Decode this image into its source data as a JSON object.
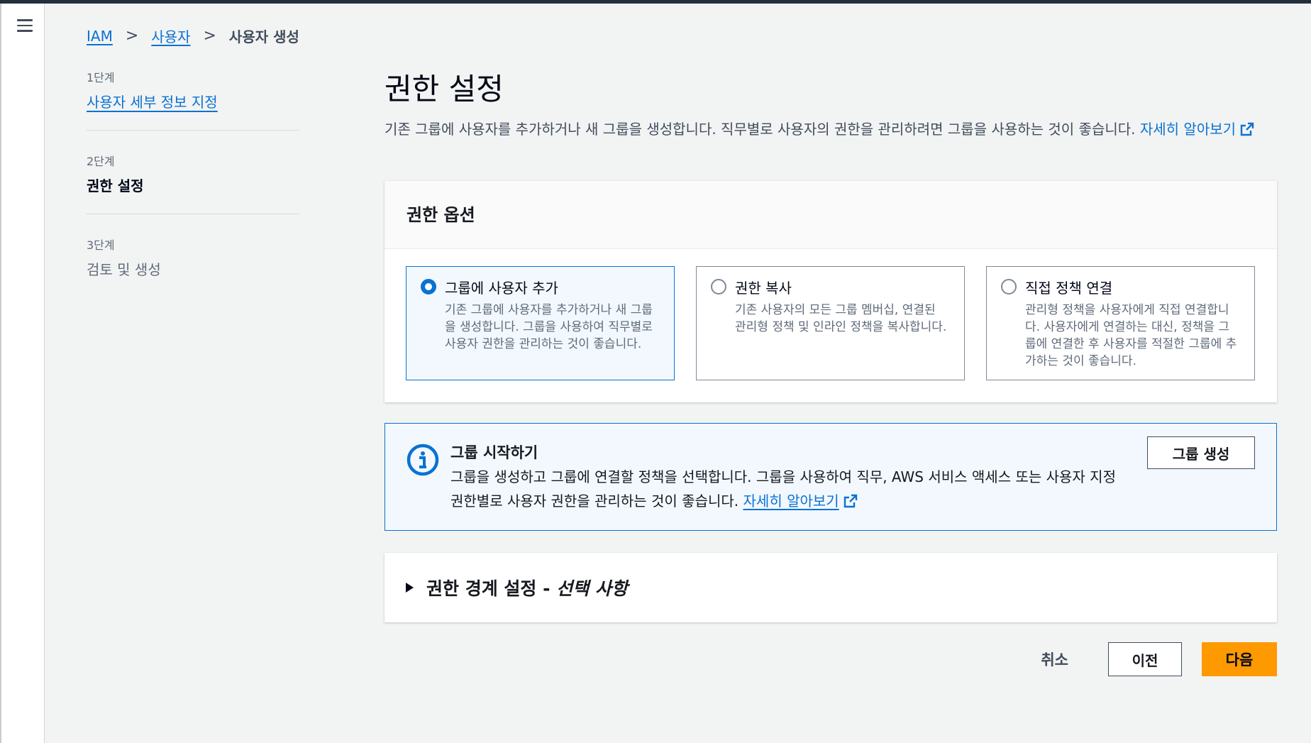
{
  "breadcrumb": {
    "iam": "IAM",
    "users": "사용자",
    "current": "사용자 생성"
  },
  "steps": [
    {
      "num": "1단계",
      "label": "사용자 세부 정보 지정"
    },
    {
      "num": "2단계",
      "label": "권한 설정"
    },
    {
      "num": "3단계",
      "label": "검토 및 생성"
    }
  ],
  "page": {
    "title": "권한 설정",
    "description": "기존 그룹에 사용자를 추가하거나 새 그룹을 생성합니다. 직무별로 사용자의 권한을 관리하려면 그룹을 사용하는 것이 좋습니다. ",
    "learn_more": "자세히 알아보기"
  },
  "permissions": {
    "header": "권한 옵션",
    "options": [
      {
        "title": "그룹에 사용자 추가",
        "desc": "기존 그룹에 사용자를 추가하거나 새 그룹을 생성합니다. 그룹을 사용하여 직무별로 사용자 권한을 관리하는 것이 좋습니다.",
        "selected": true
      },
      {
        "title": "권한 복사",
        "desc": "기존 사용자의 모든 그룹 멤버십, 연결된 관리형 정책 및 인라인 정책을 복사합니다.",
        "selected": false
      },
      {
        "title": "직접 정책 연결",
        "desc": "관리형 정책을 사용자에게 직접 연결합니다. 사용자에게 연결하는 대신, 정책을 그룹에 연결한 후 사용자를 적절한 그룹에 추가하는 것이 좋습니다.",
        "selected": false
      }
    ]
  },
  "info": {
    "title": "그룹 시작하기",
    "body": "그룹을 생성하고 그룹에 연결할 정책을 선택합니다. 그룹을 사용하여 직무, AWS 서비스 액세스 또는 사용자 지정 권한별로 사용자 권한을 관리하는 것이 좋습니다. ",
    "learn_more": "자세히 알아보기",
    "button": "그룹 생성",
    "accent": "#0972d3"
  },
  "boundary": {
    "title": "권한 경계 설정 - ",
    "optional": "선택 사항"
  },
  "footer": {
    "cancel": "취소",
    "previous": "이전",
    "next": "다음",
    "next_color": "#ff9900"
  },
  "icons": {
    "menu": "hamburger-menu-icon",
    "info": "info-icon",
    "external": "external-link-icon",
    "caret": "caret-right-icon"
  }
}
